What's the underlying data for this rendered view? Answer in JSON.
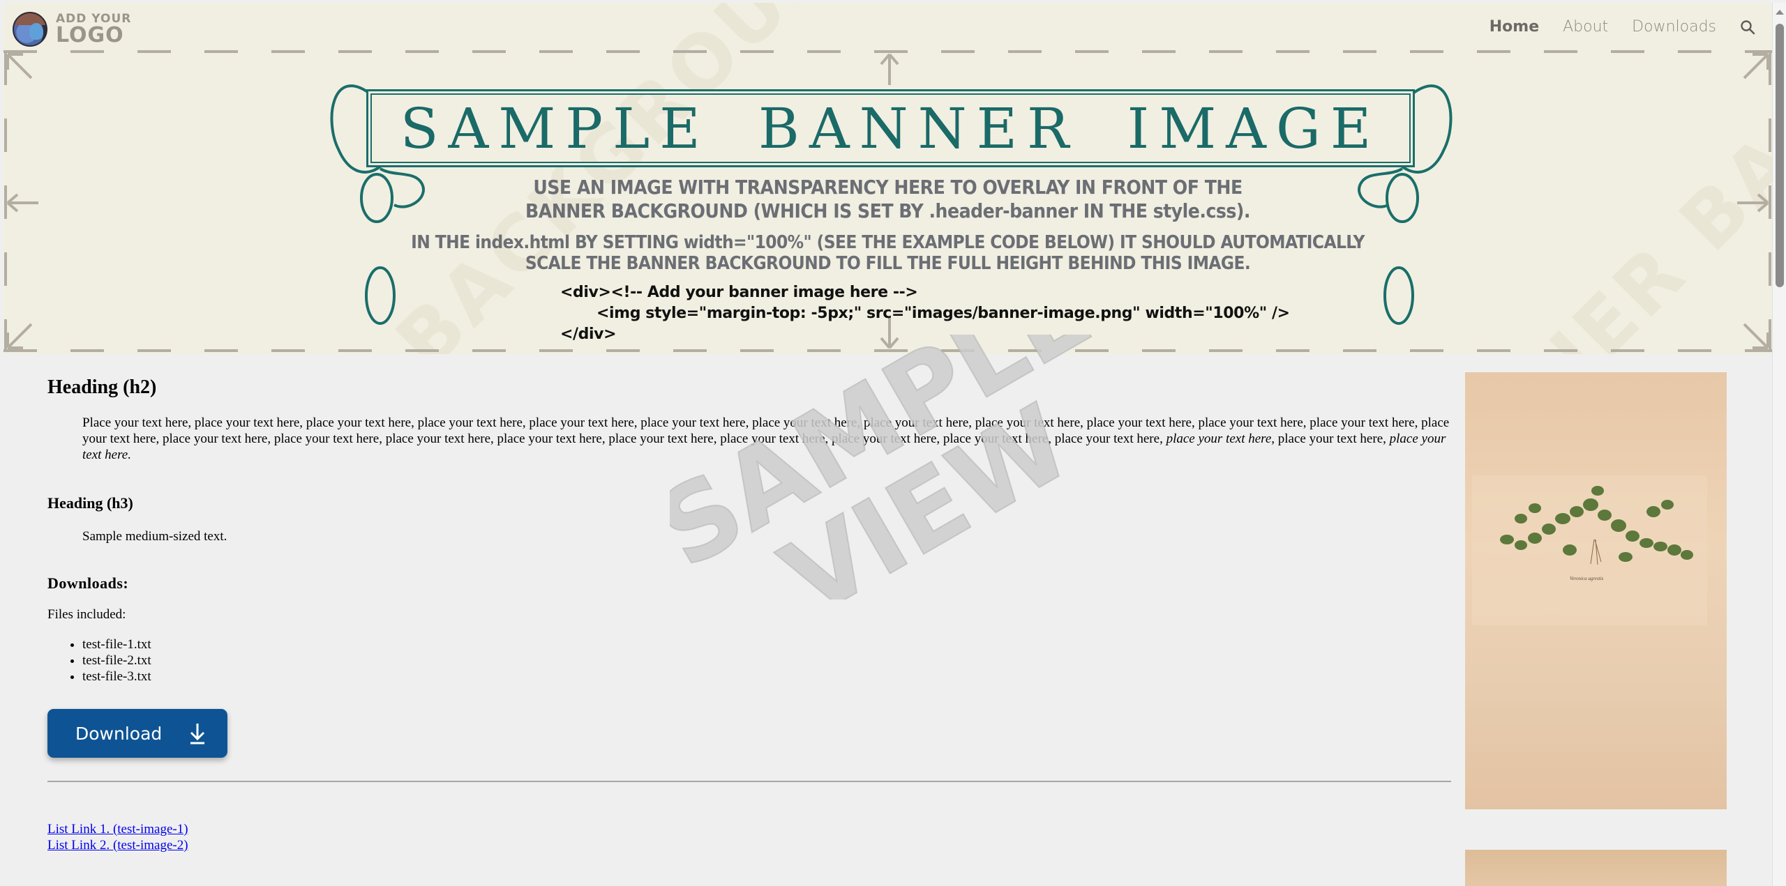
{
  "header": {
    "logo": {
      "line1": "ADD YOUR",
      "line2": "LOGO",
      "icon": "lion-logo-icon"
    },
    "nav": [
      {
        "label": "Home",
        "active": true
      },
      {
        "label": "About",
        "active": false
      },
      {
        "label": "Downloads",
        "active": false
      }
    ],
    "search_icon": "search-icon",
    "banner": {
      "watermark": "BANNER BACKGROUND",
      "title": "SAMPLE BANNER IMAGE",
      "subtitle_line1": "USE AN IMAGE WITH TRANSPARENCY HERE TO OVERLAY IN FRONT OF THE",
      "subtitle_line2": "BANNER BACKGROUND (WHICH IS SET BY .header-banner IN THE style.css).",
      "subtitle_line3": "IN THE index.html BY SETTING width=\"100%\"  (SEE THE EXAMPLE CODE BELOW) IT SHOULD AUTOMATICALLY",
      "subtitle_line4": "SCALE THE BANNER BACKGROUND TO FILL THE FULL HEIGHT BEHIND THIS IMAGE.",
      "code_line1": "<div><!-- Add your banner image here -->",
      "code_line2": "<img style=\"margin-top: -5px;\" src=\"images/banner-image.png\" width=\"100%\" />",
      "code_line3": "</div>"
    }
  },
  "main": {
    "heading_h2": "Heading (h2)",
    "paragraph_plain": "Place your text here, place your text here, place your text here, place your text here, place your text here, place your text here, place your text here, place your text here, place your text here, place your text here, place your text here, place your text here, place your text here, place your text here, place your text here, place your text here, place your text here, place your text here, place your text here, place your text here, place your text here, place your text here,",
    "paragraph_italic_1": "place your text here,",
    "paragraph_mid": " place your text here,",
    "paragraph_italic_2": "place your text here.",
    "heading_h3": "Heading (h3)",
    "medium_text": "Sample medium-sized text.",
    "downloads_heading": "Downloads:",
    "files_label": "Files included:",
    "files": [
      "test-file-1.txt",
      "test-file-2.txt",
      "test-file-3.txt"
    ],
    "download_button": "Download",
    "links": [
      "List Link 1. (test-image-1)",
      "List Link 2. (test-image-2)"
    ]
  },
  "sidebar_images": [
    {
      "alt": "Botanical illustration",
      "caption": "Veronica agrestis"
    },
    {
      "alt": "Botanical illustration"
    }
  ],
  "overlay_watermark": {
    "line1": "SAMPLE",
    "line2": "VIEW"
  },
  "colors": {
    "accent": "#0e5494",
    "banner_bg": "#f1efe1",
    "banner_teal": "#1a6a68",
    "link": "#0000ee",
    "page_bg": "#efefef"
  }
}
